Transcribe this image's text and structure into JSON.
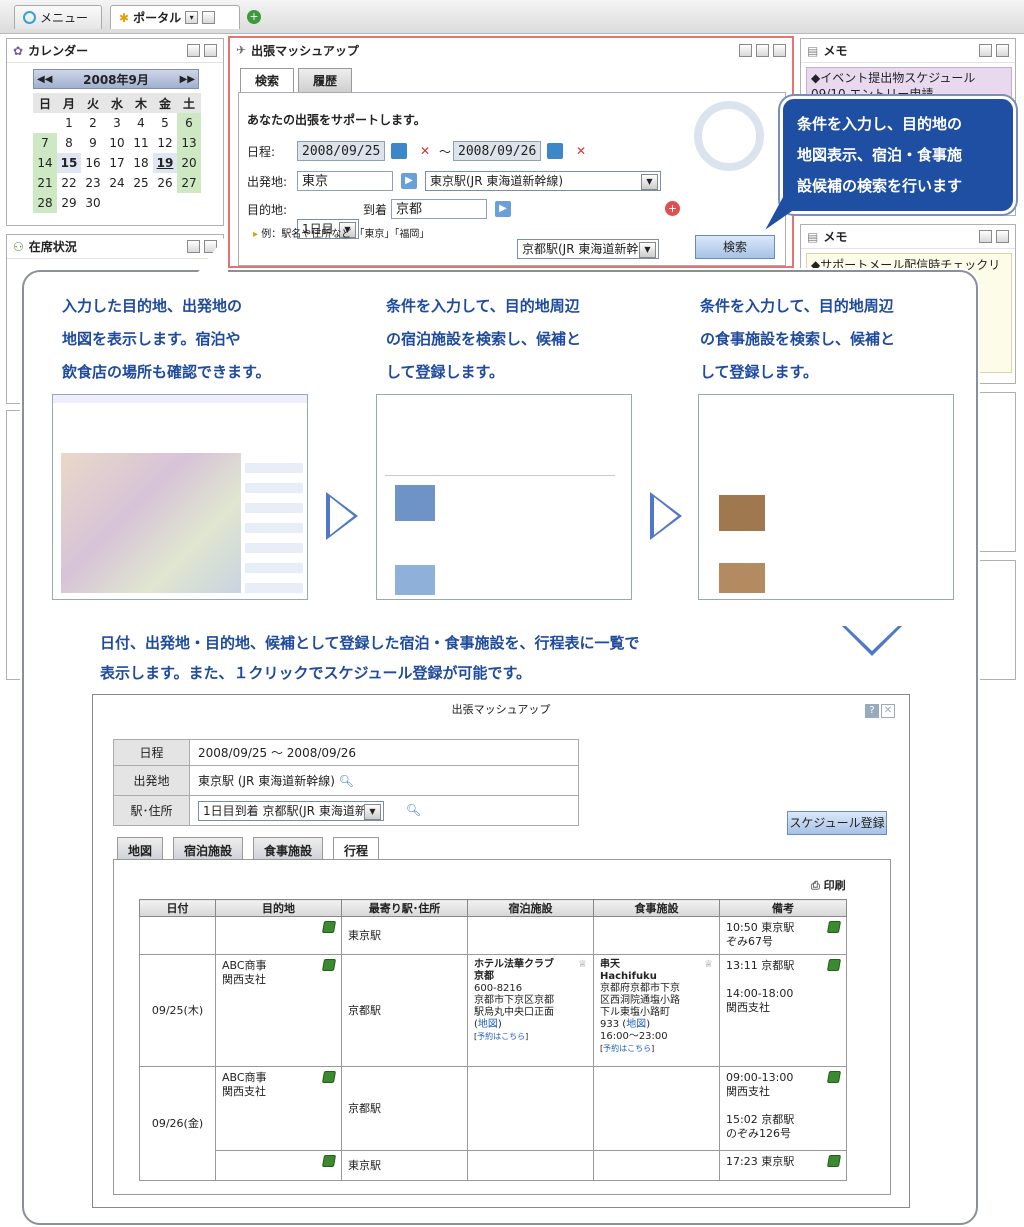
{
  "tabbar": {
    "menu_label": "メニュー",
    "portal_label": "ポータル"
  },
  "calendar": {
    "title": "カレンダー",
    "month": "2008年9月",
    "weekdays": [
      "日",
      "月",
      "火",
      "水",
      "木",
      "金",
      "土"
    ],
    "weeks": [
      [
        "",
        "1",
        "2",
        "3",
        "4",
        "5",
        "6"
      ],
      [
        "7",
        "8",
        "9",
        "10",
        "11",
        "12",
        "13"
      ],
      [
        "14",
        "15",
        "16",
        "17",
        "18",
        "19",
        "20"
      ],
      [
        "21",
        "22",
        "23",
        "24",
        "25",
        "26",
        "27"
      ],
      [
        "28",
        "29",
        "30",
        "",
        "",
        "",
        ""
      ]
    ]
  },
  "presence": {
    "title": "在席状況"
  },
  "memo1": {
    "title": "メモ",
    "lines": [
      "◆イベント提出物スケジュール",
      "09/10 エントリー申請"
    ]
  },
  "memo2": {
    "title": "メモ",
    "lines": [
      "◆サポートメール配信時チェックリスト"
    ]
  },
  "app": {
    "title": "出張マッシュアップ",
    "tab_search": "検索",
    "tab_history": "履歴",
    "intro": "あなたの出張をサポートします。",
    "date_label": "日程:",
    "date_from": "2008/09/25",
    "tilde": "～",
    "date_to": "2008/09/26",
    "origin_label": "出発地:",
    "origin_value": "東京",
    "origin_station": "東京駅(JR 東海道新幹線)",
    "dest_label": "目的地:",
    "dest_day": "1日目",
    "arrive_label": "到着",
    "dest_value": "京都",
    "dest_station": "京都駅(JR 東海道新幹",
    "example": "例：駅名や住所など 「東京」「福岡」",
    "search_button": "検索"
  },
  "callout": {
    "lines": [
      "条件を入力し、目的地の",
      "地図表示、宿泊・食事施",
      "設候補の検索を行います"
    ]
  },
  "steps": {
    "map": [
      "入力した目的地、出発地の",
      "地図を表示します。宿泊や",
      "飲食店の場所も確認できます。"
    ],
    "hotel": [
      "条件を入力して、目的地周辺",
      "の宿泊施設を検索し、候補と",
      "して登録します。"
    ],
    "food": [
      "条件を入力して、目的地周辺",
      "の食事施設を検索し、候補と",
      "して登録します。"
    ],
    "summary": [
      "日付、出発地・目的地、候補として登録した宿泊・食事施設を、行程表に一覧で",
      "表示します。また、１クリックでスケジュール登録が可能です。"
    ]
  },
  "itinerary": {
    "title": "出張マッシュアップ",
    "info_rows": [
      {
        "label": "日程",
        "value": "2008/09/25 ～ 2008/09/26"
      },
      {
        "label": "出発地",
        "value": "東京駅 (JR 東海道新幹線)"
      },
      {
        "label": "駅･住所",
        "value": "1日目到着 京都駅(JR 東海道新幹"
      }
    ],
    "schedule_button": "スケジュール登録",
    "tabs": [
      "地図",
      "宿泊施設",
      "食事施設",
      "行程"
    ],
    "print": "印刷",
    "columns": [
      "日付",
      "目的地",
      "最寄り駅･住所",
      "宿泊施設",
      "食事施設",
      "備考"
    ],
    "rows": [
      {
        "date": "",
        "dest": "",
        "station": "東京駅",
        "hotel": [],
        "food": [],
        "note": [
          "10:50 東京駅",
          "ぞみ67号"
        ]
      },
      {
        "date": "09/25(木)",
        "dest": [
          "ABC商事",
          "関西支社"
        ],
        "station": "京都駅",
        "hotel": [
          "ホテル法華クラブ",
          "京都",
          "600-8216",
          "京都市下京区京都",
          "駅烏丸中央口正面"
        ],
        "hotel_map": "地図",
        "hotel_reserve": "予約はこちら",
        "food": [
          "串天",
          "Hachifuku",
          "京都府京都市下京",
          "区西洞院通塩小路",
          "下ル東塩小路町",
          "933"
        ],
        "food_map": "地図",
        "food_hours": "16:00～23:00",
        "food_reserve": "予約はこちら",
        "note": [
          "13:11 京都駅",
          "",
          "14:00-18:00",
          "関西支社"
        ]
      },
      {
        "date": "09/26(金)",
        "dest": [
          "ABC商事",
          "関西支社"
        ],
        "station": "京都駅",
        "hotel": [],
        "food": [],
        "note": [
          "09:00-13:00",
          "関西支社",
          "",
          "15:02 京都駅",
          "のぞみ126号"
        ]
      },
      {
        "date": "",
        "dest": "",
        "station": "東京駅",
        "hotel": [],
        "food": [],
        "note": [
          "17:23 東京駅"
        ]
      }
    ]
  },
  "colors": {
    "accent": "#1f4b9e",
    "callout_bg": "#1f4fa3",
    "highlight_border": "#e57373",
    "arrow": "#5077c8"
  }
}
